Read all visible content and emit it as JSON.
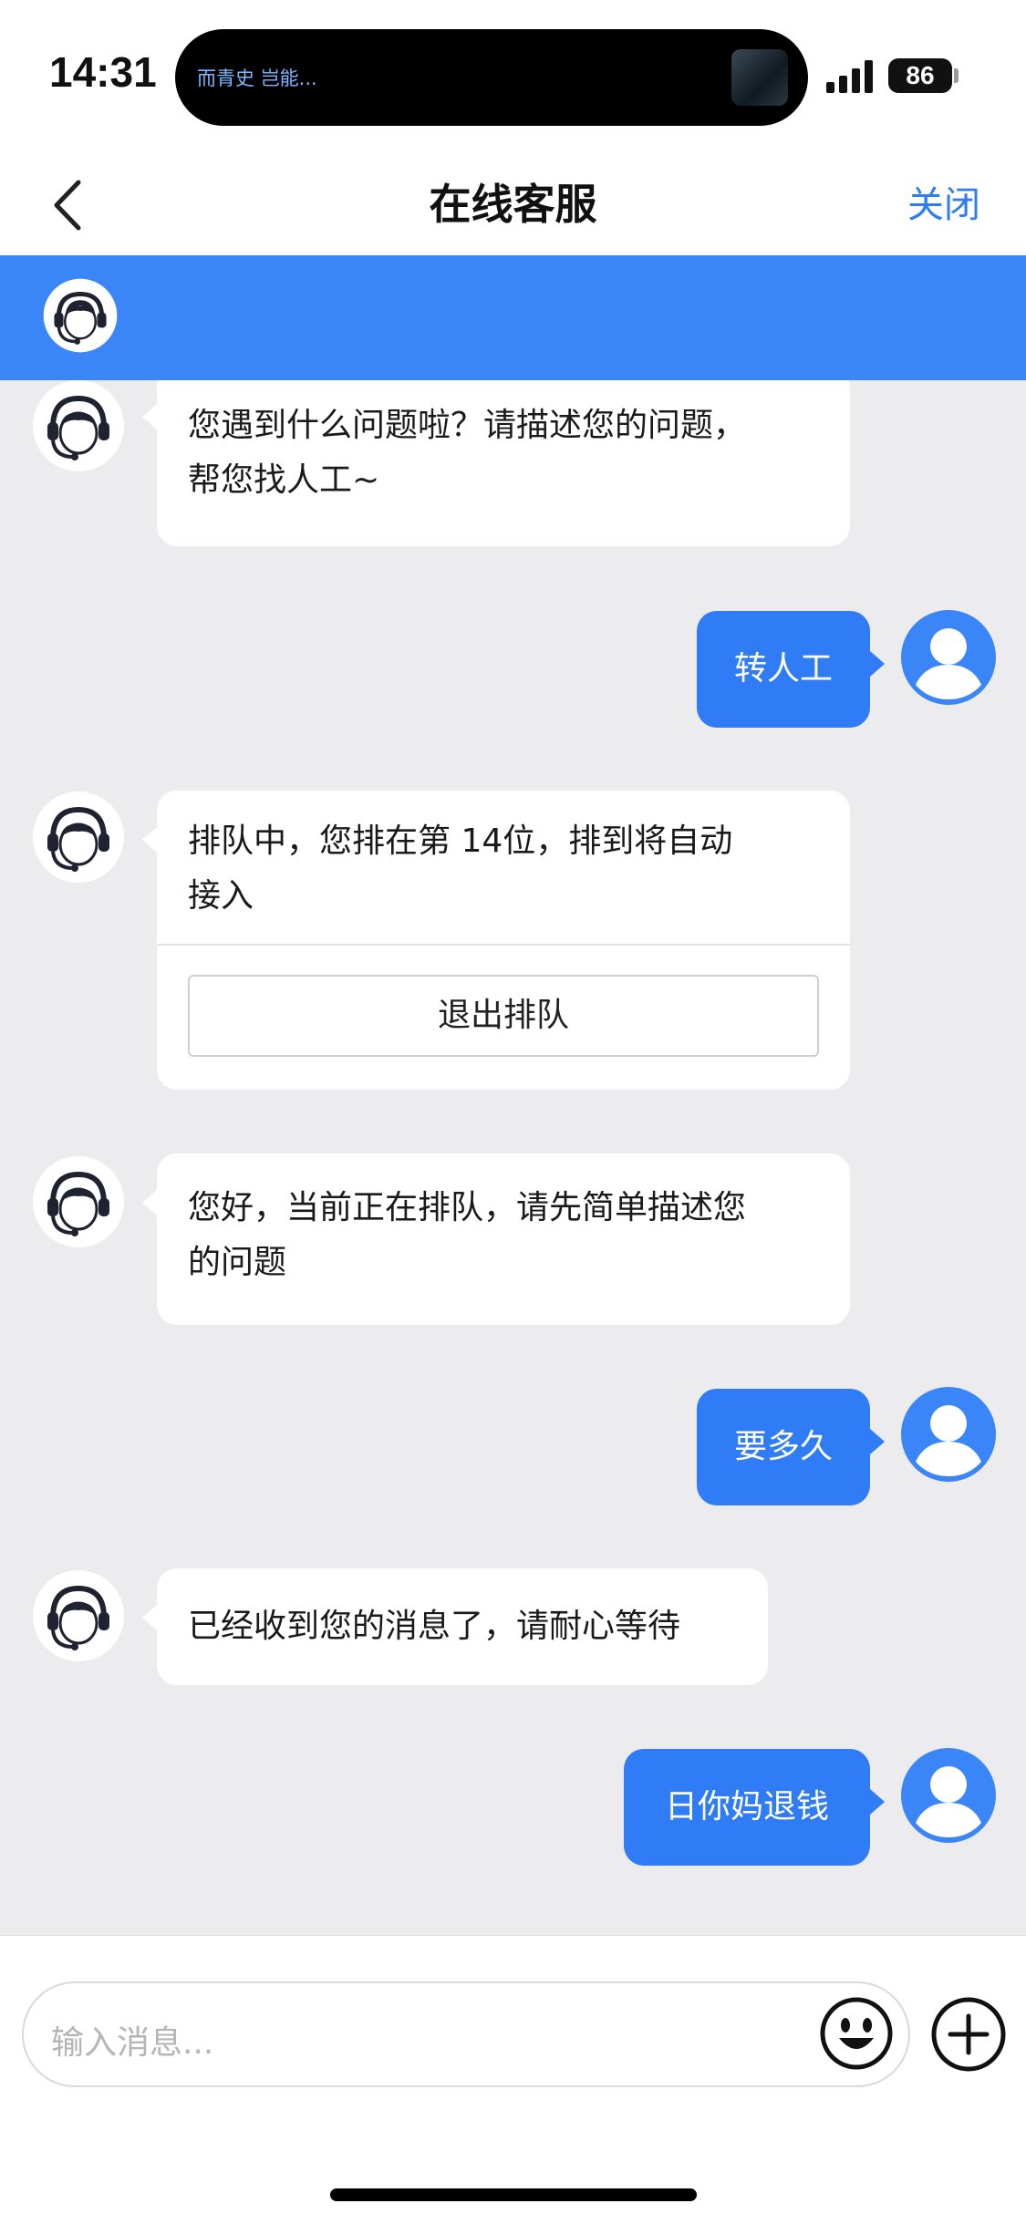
{
  "status_bar": {
    "time": "14:31",
    "now_playing": "而青史 岂能...",
    "battery": "86"
  },
  "nav": {
    "title": "在线客服",
    "close_label": "关闭"
  },
  "colors": {
    "accent": "#2f7cf6",
    "banner": "#3a86f8",
    "chat_bg": "#ececef"
  },
  "messages": [
    {
      "side": "agent",
      "text_line1": "您遇到什么问题啦？请描述您的问题，",
      "text_line2": "帮您找人工~"
    },
    {
      "side": "user",
      "text": "转人工"
    },
    {
      "side": "agent",
      "text_line1": "排队中，您排在第 14位，排到将自动",
      "text_line2": "接入",
      "button": "退出排队"
    },
    {
      "side": "agent",
      "text_line1": "您好，当前正在排队，请先简单描述您",
      "text_line2": "的问题"
    },
    {
      "side": "user",
      "text": "要多久"
    },
    {
      "side": "agent",
      "text": "已经收到您的消息了，请耐心等待"
    },
    {
      "side": "user",
      "text": "日你妈退钱"
    }
  ],
  "input": {
    "placeholder": "输入消息..."
  },
  "icons": {
    "back": "chevron-left-icon",
    "agent_avatar": "headset-agent-icon",
    "user_avatar": "user-silhouette-icon",
    "emoji": "smiley-icon",
    "plus": "plus-circle-icon"
  }
}
